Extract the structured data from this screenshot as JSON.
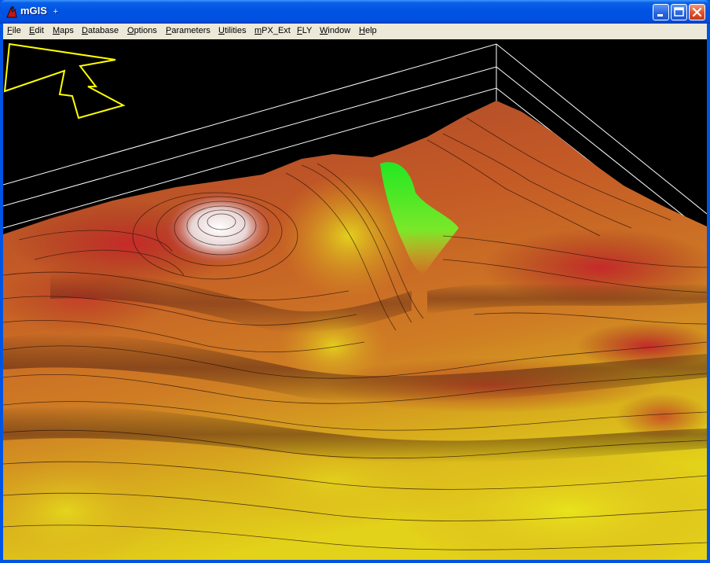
{
  "window": {
    "title": "mGIS",
    "title_suffix": "+"
  },
  "titlebar_buttons": [
    "minimize-icon",
    "maximize-icon",
    "close-icon"
  ],
  "menu": {
    "items": [
      "File",
      "Edit",
      "Maps",
      "Database",
      "Options",
      "Parameters",
      "Utilities",
      "mPX_Ext",
      "FLY",
      "Window",
      "Help"
    ]
  },
  "viewport": {
    "content": "3d-terrain-render",
    "background": "#000000",
    "north_arrow_color": "#ffff00",
    "frame_line_color": "#ffffff",
    "palette": [
      "#8a2a2a",
      "#c0392b",
      "#d2691e",
      "#e6a020",
      "#e8e020",
      "#2ee82e",
      "#ffffff"
    ]
  }
}
